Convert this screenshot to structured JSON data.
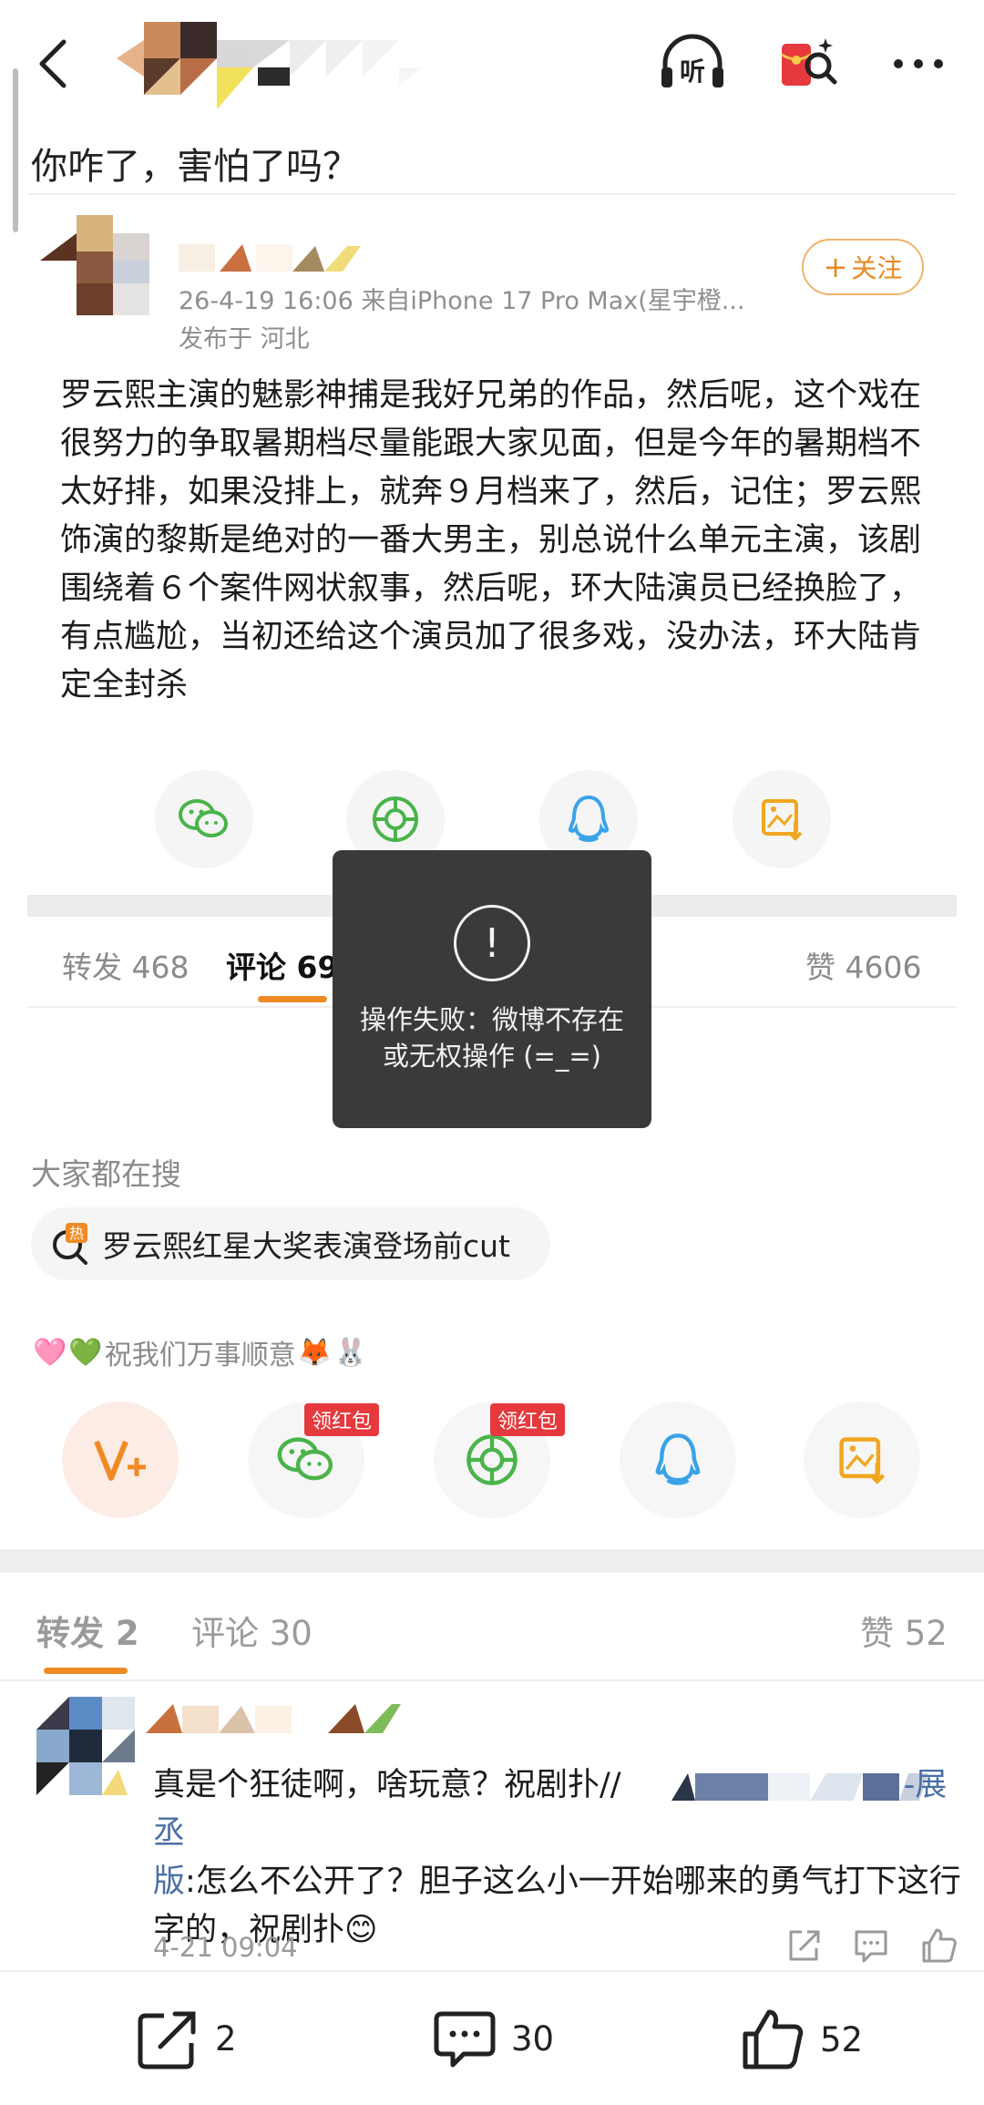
{
  "nav": {
    "back_icon": "chevron-left-icon",
    "listen_label": "听",
    "icons": [
      "headphones-listen-icon",
      "red-packet-search-icon",
      "more-icon"
    ]
  },
  "page_title": "你咋了，害怕了吗？",
  "post": {
    "meta_line1": "26-4-19 16:06  来自iPhone 17 Pro Max(星宇橙...",
    "meta_line2": "发布于 河北",
    "follow_label": "关注",
    "text": "罗云熙主演的魅影神捕是我好兄弟的作品，然后呢，这个戏在很努力的争取暑期档尽量能跟大家见面，但是今年的暑期档不太好排，如果没排上，就奔９月档来了，然后，记住；罗云熙饰演的黎斯是绝对的一番大男主，别总说什么单元主演，该剧围绕着６个案件网状叙事，然后呢，环大陆演员已经换脸了，有点尴尬，当初还给这个演员加了很多戏，没办法，环大陆肯定全封杀",
    "share_icons": [
      "wechat-icon",
      "moments-icon",
      "qq-icon",
      "save-image-icon"
    ]
  },
  "tabs_top": {
    "repost": "转发 468",
    "comment": "评论 692",
    "like": "赞 4606"
  },
  "toast": {
    "icon": "!",
    "message": "操作失败：微博不存在或无权操作 (=_=)"
  },
  "search": {
    "title": "大家都在搜",
    "hot_badge": "热",
    "query": "罗云熙红星大奖表演登场前cut"
  },
  "wish": {
    "text": "祝我们万事顺意",
    "emoji_before": [
      "🩷",
      "💚"
    ],
    "emoji_after": [
      "🦊",
      "🐰"
    ]
  },
  "share_row": {
    "icons": [
      "weibo-vplus-icon",
      "wechat-icon",
      "moments-icon",
      "qq-icon",
      "save-image-icon"
    ],
    "badge": "领红包"
  },
  "tabs_bottom": {
    "repost": "转发 2",
    "comment": "评论 30",
    "like": "赞 52"
  },
  "comment": {
    "text_a": "真是个狂徒啊，啥玩意？祝剧扑//",
    "link_a": "-展丞",
    "link_b": "版",
    "text_b": ":怎么不公开了？胆子这么小一开始哪来的勇气打下这行字的，祝剧扑",
    "emoji": "😊",
    "time": "4-21 09:04"
  },
  "bottom_bar": {
    "repost_count": "2",
    "comment_count": "30",
    "like_count": "52"
  },
  "colors": {
    "accent": "#f08a24",
    "toast_bg": "#3a3a3a",
    "link": "#4a6fa5",
    "badge": "#e5393d"
  }
}
